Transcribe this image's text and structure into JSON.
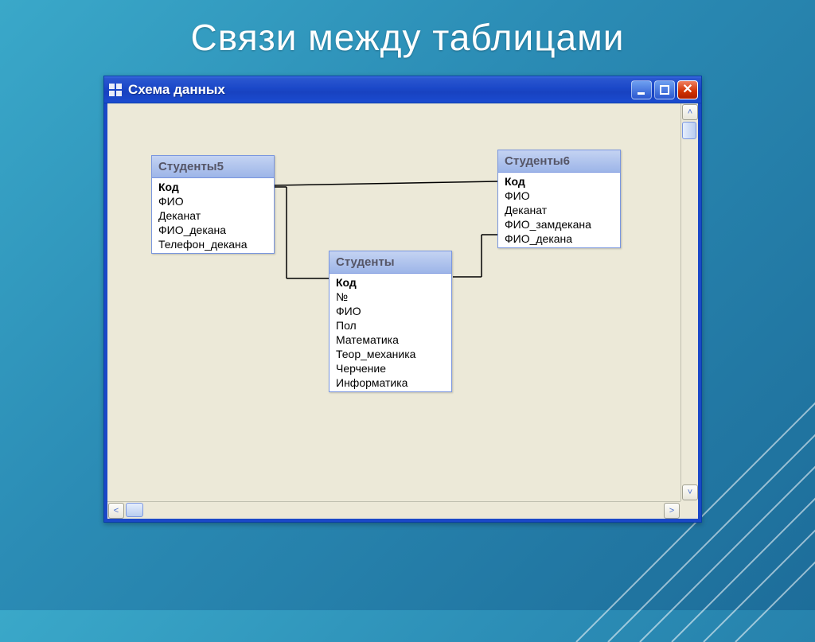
{
  "slide": {
    "title": "Связи между таблицами"
  },
  "window": {
    "title": "Схема данных"
  },
  "entities": {
    "students5": {
      "title": "Студенты5",
      "fields": [
        "Код",
        "ФИО",
        "Деканат",
        "ФИО_декана",
        "Телефон_декана"
      ]
    },
    "students": {
      "title": "Студенты",
      "fields": [
        "Код",
        "№",
        "ФИО",
        "Пол",
        "Математика",
        "Теор_механика",
        "Черчение",
        "Информатика"
      ]
    },
    "students6": {
      "title": "Студенты6",
      "fields": [
        "Код",
        "ФИО",
        "Деканат",
        "ФИО_замдекана",
        "ФИО_декана"
      ]
    }
  },
  "chart_data": {
    "type": "table",
    "description": "MS Access relationships diagram with three tables joined via Код",
    "tables": [
      {
        "name": "Студенты5",
        "primary_key": "Код",
        "fields": [
          "Код",
          "ФИО",
          "Деканат",
          "ФИО_декана",
          "Телефон_декана"
        ]
      },
      {
        "name": "Студенты",
        "primary_key": "Код",
        "fields": [
          "Код",
          "№",
          "ФИО",
          "Пол",
          "Математика",
          "Теор_механика",
          "Черчение",
          "Информатика"
        ]
      },
      {
        "name": "Студенты6",
        "primary_key": "Код",
        "fields": [
          "Код",
          "ФИО",
          "Деканат",
          "ФИО_замдекана",
          "ФИО_декана"
        ]
      }
    ],
    "relationships": [
      {
        "from": "Студенты5.Код",
        "to": "Студенты.Код"
      },
      {
        "from": "Студенты.Код",
        "to": "Студенты6.Код"
      },
      {
        "from": "Студенты5.Код",
        "to": "Студенты6.Код"
      }
    ]
  }
}
